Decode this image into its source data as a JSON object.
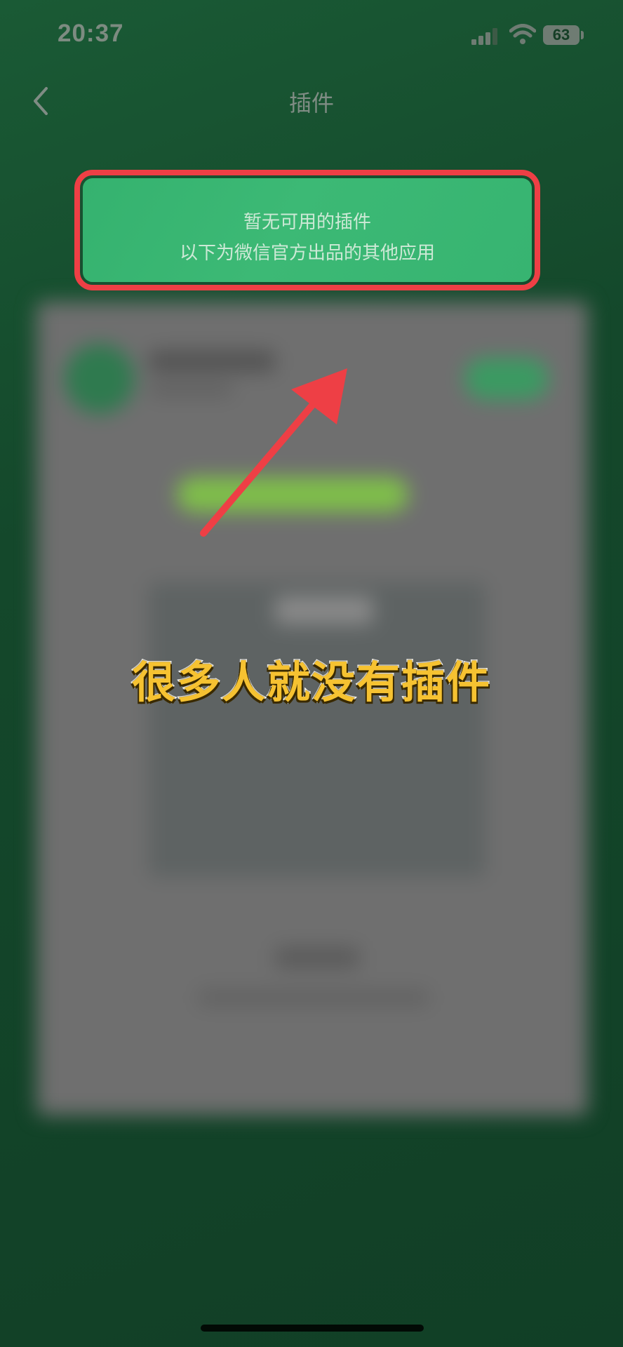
{
  "status_bar": {
    "time": "20:37",
    "battery": "63",
    "signal_icon": "signal-bars-icon",
    "wifi_icon": "wifi-icon"
  },
  "nav": {
    "title": "插件",
    "back_icon": "chevron-left-icon"
  },
  "notice": {
    "line1": "暂无可用的插件",
    "line2": "以下为微信官方出品的其他应用"
  },
  "caption": "很多人就没有插件",
  "colors": {
    "background": "#14482b",
    "notice_green": "#3cb975",
    "highlight_red": "#ee3f45",
    "caption_yellow": "#f6c231"
  }
}
